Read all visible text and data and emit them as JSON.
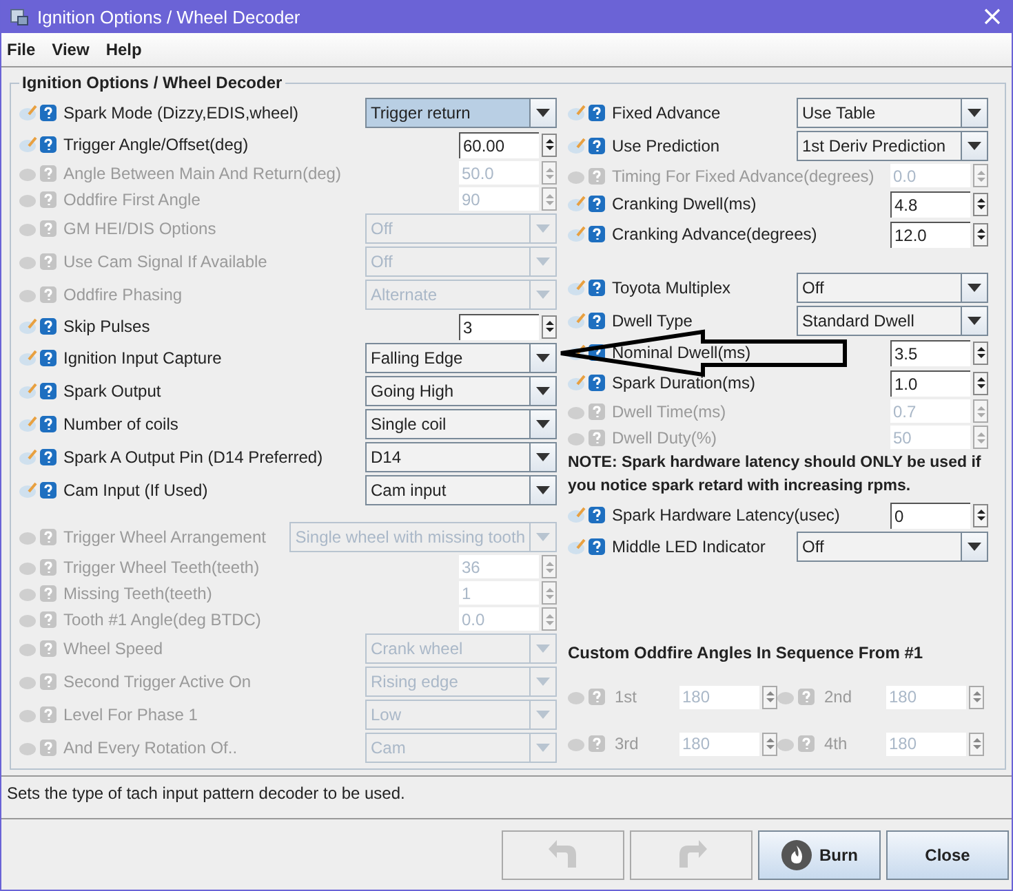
{
  "window": {
    "title": "Ignition Options / Wheel Decoder"
  },
  "menu": [
    {
      "label": "File"
    },
    {
      "label": "View"
    },
    {
      "label": "Help"
    }
  ],
  "panel": {
    "title": "Ignition Options / Wheel Decoder",
    "left": [
      {
        "rows": [
          {
            "kind": "combo",
            "label": "Spark Mode (Dizzy,EDIS,wheel)",
            "value": "Trigger return",
            "disabled": false,
            "focused": true
          },
          {
            "kind": "spin",
            "label": "Trigger Angle/Offset(deg)",
            "value": "60.00",
            "disabled": false,
            "focused": false
          },
          {
            "kind": "spin",
            "label": "Angle Between Main And Return(deg)",
            "value": "50.0",
            "disabled": true,
            "focused": false
          },
          {
            "kind": "spin",
            "label": "Oddfire First Angle",
            "value": "90",
            "disabled": true,
            "focused": false
          },
          {
            "kind": "combo",
            "label": "GM HEI/DIS Options",
            "value": "Off",
            "disabled": true,
            "focused": false
          },
          {
            "kind": "combo",
            "label": "Use Cam Signal If Available",
            "value": "Off",
            "disabled": true,
            "focused": false
          },
          {
            "kind": "combo",
            "label": "Oddfire Phasing",
            "value": "Alternate",
            "disabled": true,
            "focused": false
          },
          {
            "kind": "spin",
            "label": "Skip Pulses",
            "value": "3",
            "disabled": false,
            "focused": false
          },
          {
            "kind": "combo",
            "label": "Ignition Input Capture",
            "value": "Falling Edge",
            "disabled": false,
            "focused": false
          },
          {
            "kind": "combo",
            "label": "Spark Output",
            "value": "Going High",
            "disabled": false,
            "focused": false
          },
          {
            "kind": "combo",
            "label": "Number of coils",
            "value": "Single coil",
            "disabled": false,
            "focused": false
          },
          {
            "kind": "combo",
            "label": "Spark A Output Pin (D14 Preferred)",
            "value": "D14",
            "disabled": false,
            "focused": false
          },
          {
            "kind": "combo",
            "label": "Cam Input (If Used)",
            "value": "Cam input",
            "disabled": false,
            "focused": false
          }
        ]
      },
      {
        "rows": [
          {
            "kind": "combo",
            "label": "Trigger Wheel Arrangement",
            "value": "Single wheel with missing tooth",
            "disabled": true,
            "focused": false
          },
          {
            "kind": "spin",
            "label": "Trigger Wheel Teeth(teeth)",
            "value": "36",
            "disabled": true,
            "focused": false
          },
          {
            "kind": "spin",
            "label": "Missing Teeth(teeth)",
            "value": "1",
            "disabled": true,
            "focused": false
          },
          {
            "kind": "spin",
            "label": "Tooth #1 Angle(deg BTDC)",
            "value": "0.0",
            "disabled": true,
            "focused": false
          },
          {
            "kind": "combo",
            "label": "Wheel Speed",
            "value": "Crank wheel",
            "disabled": true,
            "focused": false
          },
          {
            "kind": "combo",
            "label": "Second Trigger Active On",
            "value": "Rising edge",
            "disabled": true,
            "focused": false
          },
          {
            "kind": "combo",
            "label": "Level For Phase 1",
            "value": "Low",
            "disabled": true,
            "focused": false
          },
          {
            "kind": "combo",
            "label": "And Every Rotation Of..",
            "value": "Cam",
            "disabled": true,
            "focused": false
          }
        ]
      }
    ],
    "right": [
      {
        "rows": [
          {
            "kind": "combo",
            "label": "Fixed Advance",
            "value": "Use Table",
            "disabled": false,
            "focused": false
          },
          {
            "kind": "combo",
            "label": "Use Prediction",
            "value": "1st Deriv Prediction",
            "disabled": false,
            "focused": false
          },
          {
            "kind": "spin",
            "label": "Timing For Fixed Advance(degrees)",
            "value": "0.0",
            "disabled": true,
            "focused": false
          },
          {
            "kind": "spin",
            "label": "Cranking Dwell(ms)",
            "value": "4.8",
            "disabled": false,
            "focused": false
          },
          {
            "kind": "spin",
            "label": "Cranking Advance(degrees)",
            "value": "12.0",
            "disabled": false,
            "focused": false
          }
        ]
      },
      {
        "rows": [
          {
            "kind": "combo",
            "label": "Toyota Multiplex",
            "value": "Off",
            "disabled": false,
            "focused": false
          },
          {
            "kind": "combo",
            "label": "Dwell Type",
            "value": "Standard Dwell",
            "disabled": false,
            "focused": false
          },
          {
            "kind": "spin",
            "label": "Nominal Dwell(ms)",
            "value": "3.5",
            "disabled": false,
            "focused": false
          },
          {
            "kind": "spin",
            "label": "Spark Duration(ms)",
            "value": "1.0",
            "disabled": false,
            "focused": false
          },
          {
            "kind": "spin",
            "label": "Dwell Time(ms)",
            "value": "0.7",
            "disabled": true,
            "focused": false
          },
          {
            "kind": "spin",
            "label": "Dwell Duty(%)",
            "value": "50",
            "disabled": true,
            "focused": false
          },
          {
            "kind": "note",
            "label": "NOTE: Spark hardware latency should ONLY be used if you notice spark retard with increasing rpms."
          },
          {
            "kind": "spin",
            "label": "Spark Hardware Latency(usec)",
            "value": "0",
            "disabled": false,
            "focused": false
          },
          {
            "kind": "combo",
            "label": "Middle LED Indicator",
            "value": "Off",
            "disabled": false,
            "focused": false
          }
        ]
      },
      {
        "rows": [
          {
            "kind": "heading",
            "label": "Custom Oddfire Angles In Sequence From #1"
          },
          {
            "kind": "angles",
            "items": [
              {
                "label": "1st",
                "value": "180",
                "disabled": true
              },
              {
                "label": "2nd",
                "value": "180",
                "disabled": true
              },
              {
                "label": "3rd",
                "value": "180",
                "disabled": true
              },
              {
                "label": "4th",
                "value": "180",
                "disabled": true
              }
            ]
          }
        ]
      }
    ]
  },
  "status_bar": {
    "text": "Sets the type of tach input pattern decoder to be used."
  },
  "buttons": [
    {
      "kind": "undo",
      "disabled": true
    },
    {
      "kind": "redo",
      "disabled": true
    },
    {
      "kind": "burn",
      "label": "Burn",
      "disabled": false
    },
    {
      "kind": "close",
      "label": "Close",
      "disabled": false
    }
  ]
}
